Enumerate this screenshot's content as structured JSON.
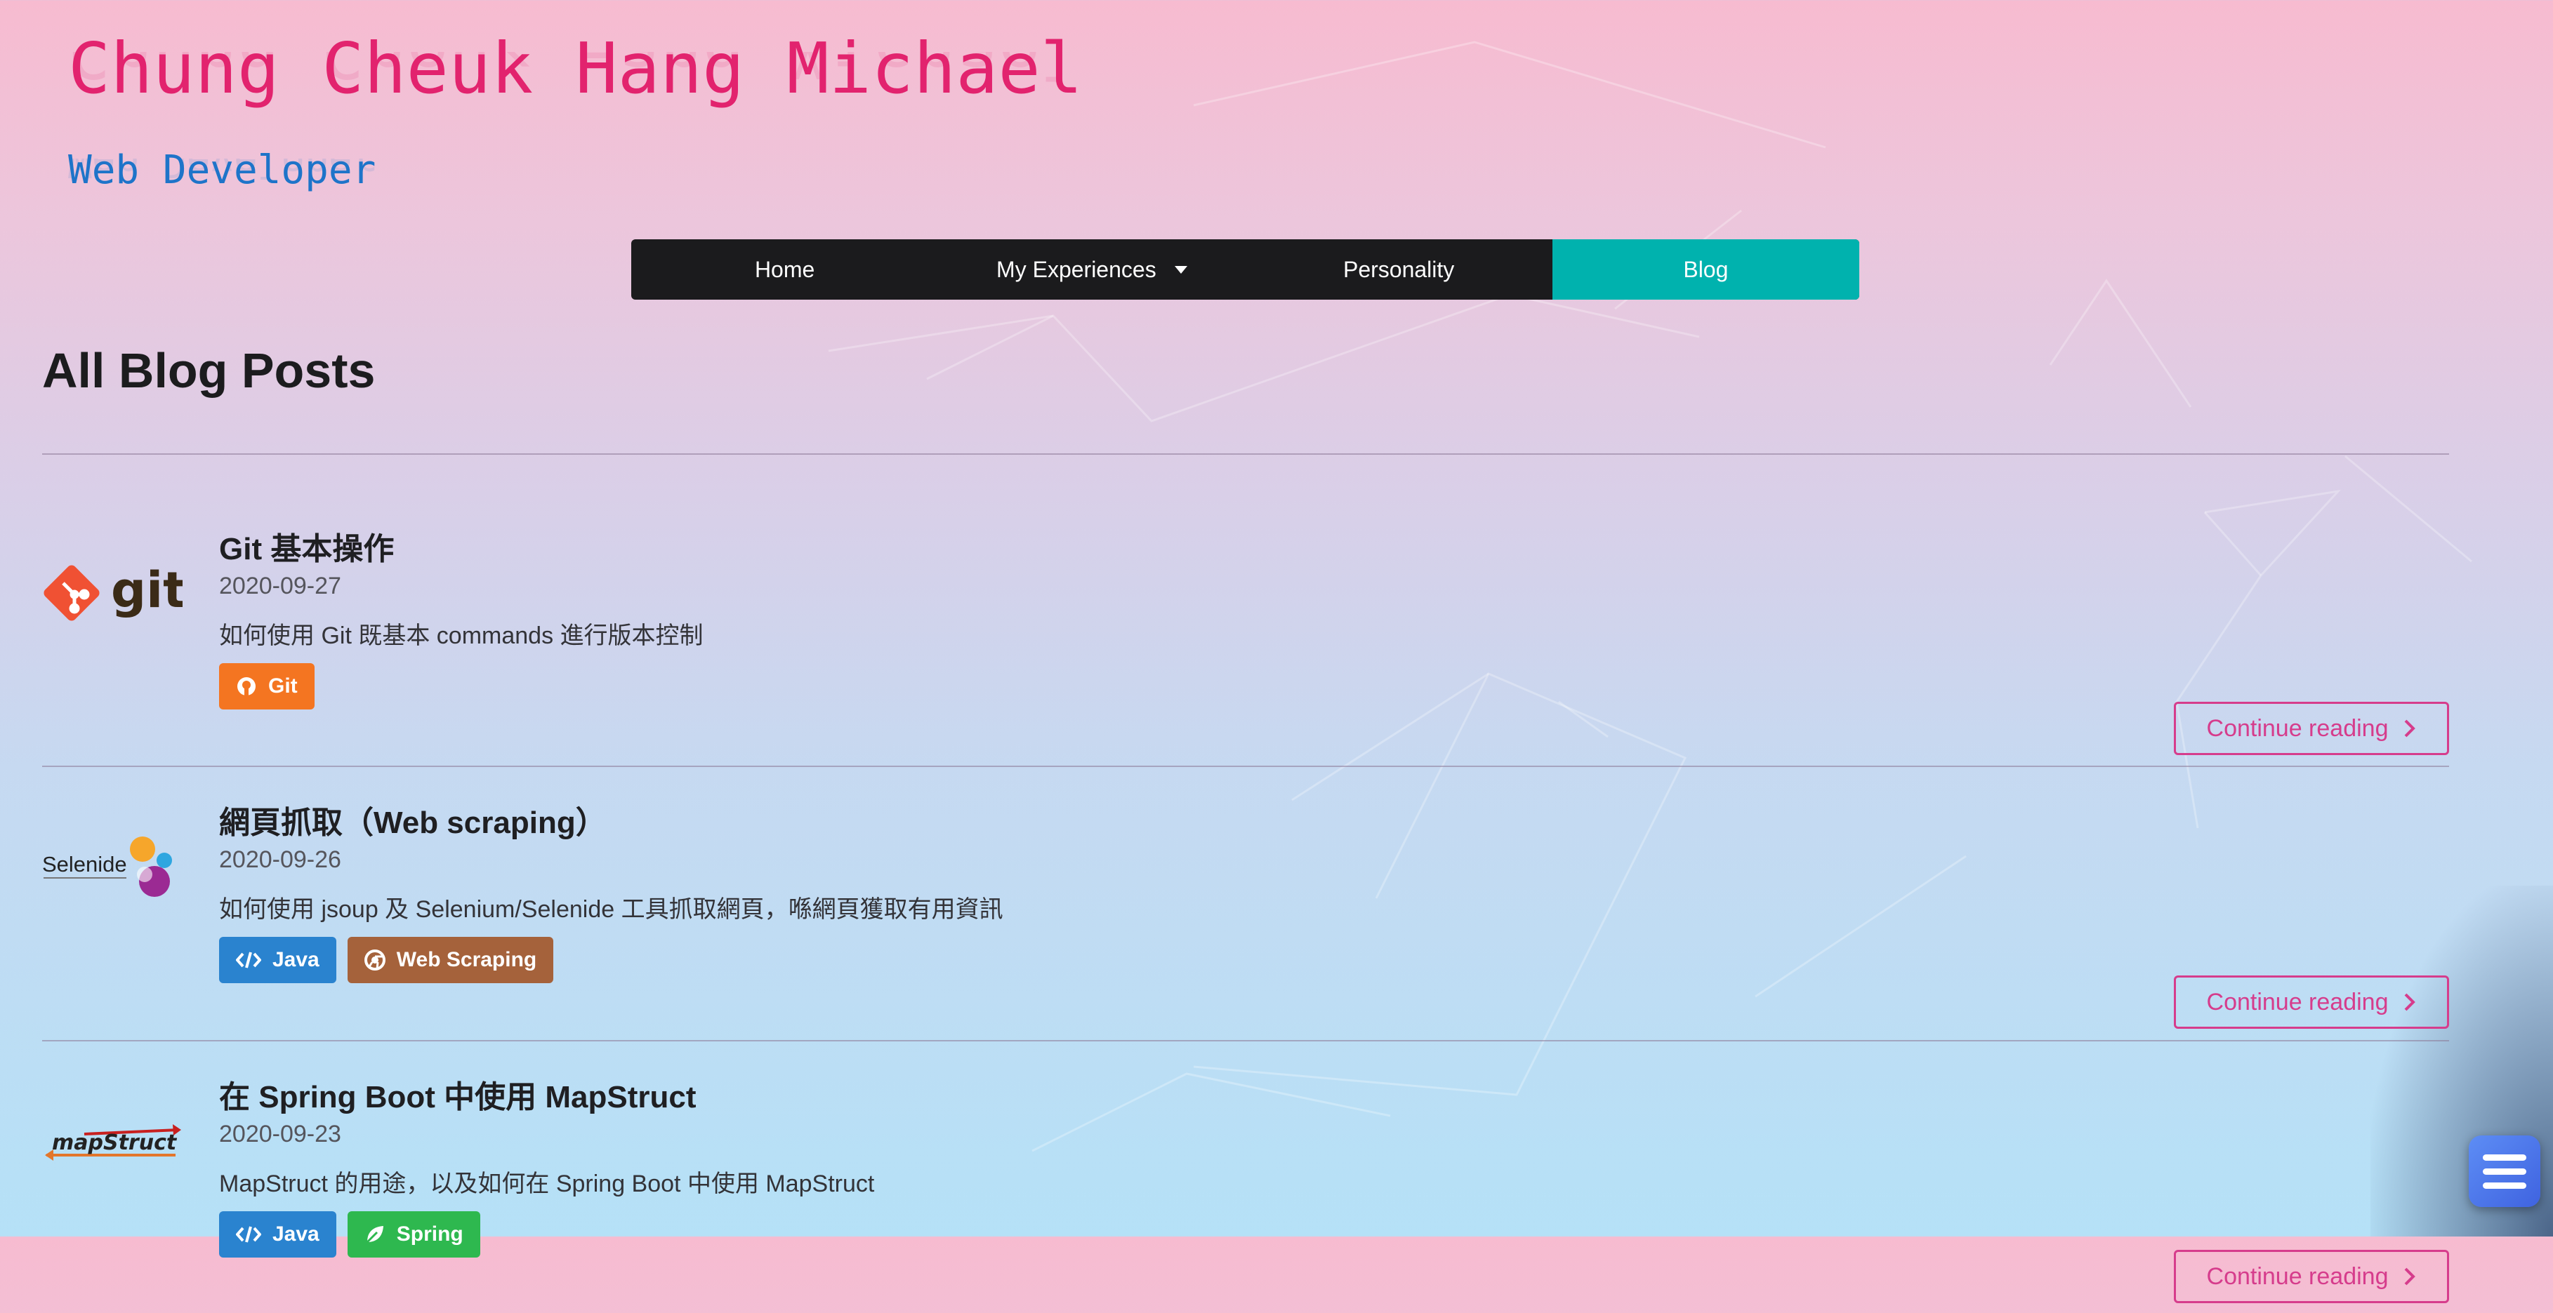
{
  "header": {
    "name": "Chung Cheuk Hang Michael",
    "role": "Web Developer"
  },
  "nav": {
    "items": [
      {
        "label": "Home",
        "active": false
      },
      {
        "label": "My Experiences",
        "active": false,
        "has_dropdown": true
      },
      {
        "label": "Personality",
        "active": false
      },
      {
        "label": "Blog",
        "active": true
      }
    ]
  },
  "page": {
    "heading": "All Blog Posts"
  },
  "posts": [
    {
      "title": "Git 基本操作",
      "date": "2020-09-27",
      "description": "如何使用 Git 既基本 commands 進行版本控制",
      "thumbnail": "git-logo",
      "thumbnail_text": "git",
      "tags": [
        {
          "label": "Git",
          "icon": "github-icon",
          "color": "#f47521"
        }
      ],
      "continue_label": "Continue reading"
    },
    {
      "title": "網頁抓取（Web scraping）",
      "date": "2020-09-26",
      "description": "如何使用 jsoup 及 Selenium/Selenide 工具抓取網頁，喺網頁獲取有用資訊",
      "thumbnail": "selenide-logo",
      "thumbnail_text": "Selenide",
      "tags": [
        {
          "label": "Java",
          "icon": "code-icon",
          "color": "#2a83cf"
        },
        {
          "label": "Web Scraping",
          "icon": "chrome-icon",
          "color": "#a5623b"
        }
      ],
      "continue_label": "Continue reading"
    },
    {
      "title": "在 Spring Boot 中使用 MapStruct",
      "date": "2020-09-23",
      "description": "MapStruct 的用途，以及如何在 Spring Boot 中使用 MapStruct",
      "thumbnail": "mapstruct-logo",
      "thumbnail_text": "mapStruct",
      "tags": [
        {
          "label": "Java",
          "icon": "code-icon",
          "color": "#2a83cf"
        },
        {
          "label": "Spring",
          "icon": "leaf-icon",
          "color": "#2eb84f"
        }
      ],
      "continue_label": "Continue reading"
    }
  ],
  "colors": {
    "accent_pink": "#e2236e",
    "accent_blue": "#1e74c9",
    "nav_active": "#00b2ae",
    "continue_border": "#d63c8c"
  }
}
